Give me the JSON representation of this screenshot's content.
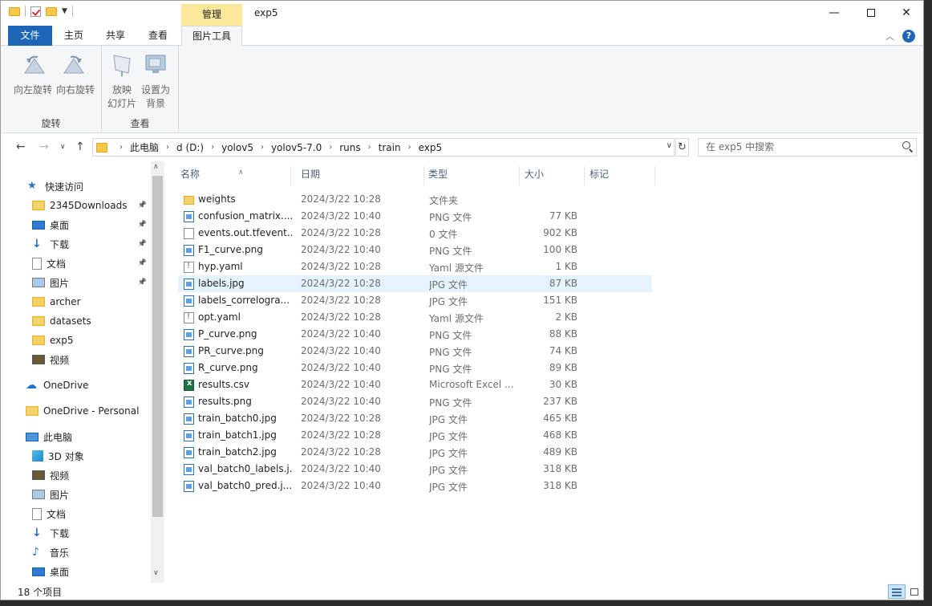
{
  "window": {
    "title": "exp5",
    "manage_label": "管理"
  },
  "ribbon_tabs": [
    {
      "label": "文件"
    },
    {
      "label": "主页"
    },
    {
      "label": "共享"
    },
    {
      "label": "查看"
    },
    {
      "label": "图片工具"
    }
  ],
  "ribbon_groups": {
    "rotate": {
      "label": "旋转",
      "left": "向左旋转",
      "right": "向右旋转"
    },
    "view": {
      "label": "查看",
      "slideshow_l1": "放映",
      "slideshow_l2": "幻灯片",
      "setbg_l1": "设置为",
      "setbg_l2": "背景"
    }
  },
  "address": {
    "crumbs": [
      "此电脑",
      "d (D:)",
      "yolov5",
      "yolov5-7.0",
      "runs",
      "train",
      "exp5"
    ],
    "search_placeholder": "在 exp5 中搜索"
  },
  "sidebar": {
    "items": [
      {
        "label": "快速访问",
        "icon": "star-icon",
        "pinned": false
      },
      {
        "label": "2345Downloads",
        "icon": "folder-icon",
        "pinned": true
      },
      {
        "label": "桌面",
        "icon": "desktop-icon",
        "pinned": true
      },
      {
        "label": "下载",
        "icon": "download-icon",
        "pinned": true
      },
      {
        "label": "文档",
        "icon": "document-icon",
        "pinned": true
      },
      {
        "label": "图片",
        "icon": "pictures-icon",
        "pinned": true
      },
      {
        "label": "archer",
        "icon": "folder-icon",
        "pinned": false
      },
      {
        "label": "datasets",
        "icon": "folder-icon",
        "pinned": false
      },
      {
        "label": "exp5",
        "icon": "folder-icon",
        "pinned": false
      },
      {
        "label": "视频",
        "icon": "video-icon",
        "pinned": false
      },
      {
        "label": "OneDrive",
        "icon": "cloud-icon",
        "pinned": false
      },
      {
        "label": "OneDrive - Personal",
        "icon": "folder-icon",
        "pinned": false
      },
      {
        "label": "此电脑",
        "icon": "computer-icon",
        "pinned": false
      },
      {
        "label": "3D 对象",
        "icon": "cube-icon",
        "pinned": false
      },
      {
        "label": "视频",
        "icon": "video-icon",
        "pinned": false
      },
      {
        "label": "图片",
        "icon": "pictures-icon",
        "pinned": false
      },
      {
        "label": "文档",
        "icon": "document-icon",
        "pinned": false
      },
      {
        "label": "下载",
        "icon": "download-icon",
        "pinned": false
      },
      {
        "label": "音乐",
        "icon": "music-icon",
        "pinned": false
      },
      {
        "label": "桌面",
        "icon": "desktop-icon",
        "pinned": false
      }
    ]
  },
  "columns": {
    "name": "名称",
    "date": "日期",
    "type": "类型",
    "size": "大小",
    "tags": "标记"
  },
  "files": [
    {
      "name": "weights",
      "date": "2024/3/22 10:28",
      "type": "文件夹",
      "size": "",
      "icon": "folder-icon"
    },
    {
      "name": "confusion_matrix....",
      "date": "2024/3/22 10:40",
      "type": "PNG 文件",
      "size": "77 KB",
      "icon": "image-file-icon"
    },
    {
      "name": "events.out.tfevent...",
      "date": "2024/3/22 10:28",
      "type": "0 文件",
      "size": "902 KB",
      "icon": "blank-file-icon"
    },
    {
      "name": "F1_curve.png",
      "date": "2024/3/22 10:40",
      "type": "PNG 文件",
      "size": "100 KB",
      "icon": "image-file-icon"
    },
    {
      "name": "hyp.yaml",
      "date": "2024/3/22 10:28",
      "type": "Yaml 源文件",
      "size": "1 KB",
      "icon": "yaml-file-icon"
    },
    {
      "name": "labels.jpg",
      "date": "2024/3/22 10:28",
      "type": "JPG 文件",
      "size": "87 KB",
      "icon": "image-file-icon",
      "selected": true
    },
    {
      "name": "labels_correlogra...",
      "date": "2024/3/22 10:28",
      "type": "JPG 文件",
      "size": "151 KB",
      "icon": "image-file-icon"
    },
    {
      "name": "opt.yaml",
      "date": "2024/3/22 10:28",
      "type": "Yaml 源文件",
      "size": "2 KB",
      "icon": "yaml-file-icon"
    },
    {
      "name": "P_curve.png",
      "date": "2024/3/22 10:40",
      "type": "PNG 文件",
      "size": "88 KB",
      "icon": "image-file-icon"
    },
    {
      "name": "PR_curve.png",
      "date": "2024/3/22 10:40",
      "type": "PNG 文件",
      "size": "74 KB",
      "icon": "image-file-icon"
    },
    {
      "name": "R_curve.png",
      "date": "2024/3/22 10:40",
      "type": "PNG 文件",
      "size": "89 KB",
      "icon": "image-file-icon"
    },
    {
      "name": "results.csv",
      "date": "2024/3/22 10:40",
      "type": "Microsoft Excel ...",
      "size": "30 KB",
      "icon": "excel-file-icon"
    },
    {
      "name": "results.png",
      "date": "2024/3/22 10:40",
      "type": "PNG 文件",
      "size": "237 KB",
      "icon": "image-file-icon"
    },
    {
      "name": "train_batch0.jpg",
      "date": "2024/3/22 10:28",
      "type": "JPG 文件",
      "size": "465 KB",
      "icon": "image-file-icon"
    },
    {
      "name": "train_batch1.jpg",
      "date": "2024/3/22 10:28",
      "type": "JPG 文件",
      "size": "468 KB",
      "icon": "image-file-icon"
    },
    {
      "name": "train_batch2.jpg",
      "date": "2024/3/22 10:28",
      "type": "JPG 文件",
      "size": "489 KB",
      "icon": "image-file-icon"
    },
    {
      "name": "val_batch0_labels.j...",
      "date": "2024/3/22 10:40",
      "type": "JPG 文件",
      "size": "318 KB",
      "icon": "image-file-icon"
    },
    {
      "name": "val_batch0_pred.j...",
      "date": "2024/3/22 10:40",
      "type": "JPG 文件",
      "size": "318 KB",
      "icon": "image-file-icon"
    }
  ],
  "status": {
    "item_count": "18 个项目"
  }
}
